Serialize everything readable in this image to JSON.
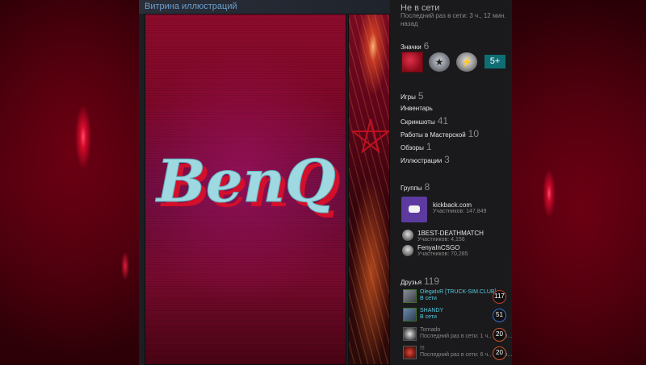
{
  "showcase": {
    "title": "Витрина иллюстраций",
    "art_text": "BenQ"
  },
  "profile": {
    "status": "Не в сети",
    "last_seen": "Последний раз в сети: 3 ч., 12 мин. назад"
  },
  "badges": {
    "label": "Значки",
    "count": "6",
    "more": "5+"
  },
  "stats": [
    {
      "label": "Игры",
      "count": "5"
    },
    {
      "label": "Инвентарь",
      "count": ""
    },
    {
      "label": "Скриншоты",
      "count": "41"
    },
    {
      "label": "Работы в Мастерской",
      "count": "10"
    },
    {
      "label": "Обзоры",
      "count": "1"
    },
    {
      "label": "Иллюстрации",
      "count": "3"
    }
  ],
  "groups": {
    "label": "Группы",
    "count": "8",
    "items": [
      {
        "name": "kickback.com",
        "members": "Участников: 147,849"
      },
      {
        "name": "1BEST-DEATHMATCH",
        "members": "Участников: 4,156"
      },
      {
        "name": "FenyaInCSGO",
        "members": "Участников: 70,285"
      }
    ]
  },
  "friends": {
    "label": "Друзья",
    "count": "119",
    "items": [
      {
        "name": "OlegaIvR [TRUCK-SIM.CLUB]",
        "status": "В сети",
        "level": "117",
        "online": true
      },
      {
        "name": "SHANDY",
        "status": "В сети",
        "level": "51",
        "online": true
      },
      {
        "name": "Tornado",
        "status": "Последний раз в сети: 1 ч., 18 ми...",
        "level": "20",
        "online": false
      },
      {
        "name": "!!!",
        "status": "Последний раз в сети: 6 ч., 21 ми...",
        "level": "20",
        "online": false
      }
    ]
  },
  "colors": {
    "online": "#57cbde",
    "offline_text": "#8a8a8a",
    "accent_blue": "#6b9fd0"
  }
}
